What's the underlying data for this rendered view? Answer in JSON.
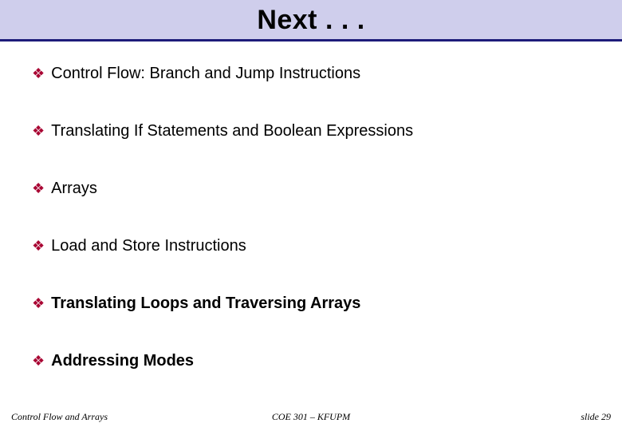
{
  "title": "Next . . .",
  "bullets": [
    {
      "text": "Control Flow: Branch and Jump Instructions",
      "bold": false
    },
    {
      "text": "Translating If Statements and Boolean Expressions",
      "bold": false
    },
    {
      "text": "Arrays",
      "bold": false
    },
    {
      "text": "Load and Store Instructions",
      "bold": false
    },
    {
      "text": "Translating Loops and Traversing Arrays",
      "bold": true
    },
    {
      "text": "Addressing Modes",
      "bold": true
    }
  ],
  "footer": {
    "left": "Control Flow and Arrays",
    "center": "COE 301 – KFUPM",
    "right": "slide 29"
  }
}
